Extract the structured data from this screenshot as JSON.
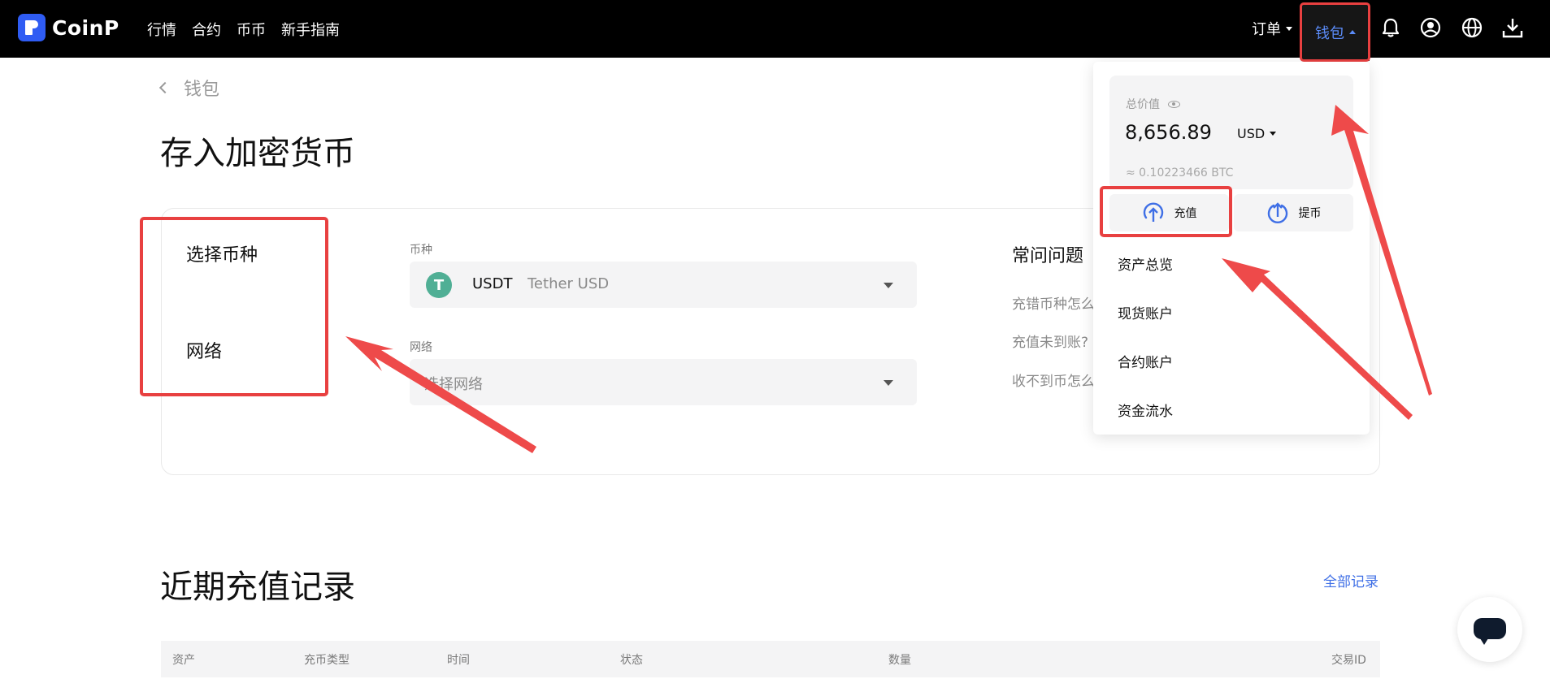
{
  "brand": {
    "name": "CoinP"
  },
  "nav": {
    "items": [
      "行情",
      "合约",
      "币币",
      "新手指南"
    ]
  },
  "nav_right": {
    "orders": "订单",
    "wallet": "钱包"
  },
  "breadcrumb": {
    "back": "钱包"
  },
  "page": {
    "title": "存入加密货币"
  },
  "steps": {
    "coin": "选择币种",
    "network": "网络"
  },
  "coin_field": {
    "label": "币种",
    "code": "USDT",
    "name": "Tether USD",
    "icon_glyph": "T"
  },
  "network_field": {
    "label": "网络",
    "placeholder": "选择网络"
  },
  "faq": {
    "title": "常问问题",
    "items": [
      "充错币种怎么",
      "充值未到账?",
      "收不到币怎么"
    ]
  },
  "recent": {
    "title": "近期充值记录",
    "all_link": "全部记录"
  },
  "table": {
    "headers": [
      "资产",
      "充币类型",
      "时间",
      "状态",
      "数量",
      "交易ID"
    ]
  },
  "dropdown": {
    "total_label": "总价值",
    "total_value": "8,656.89",
    "currency": "USD",
    "btc_value": "≈ 0.10223466 BTC",
    "deposit": "充值",
    "withdraw": "提币",
    "menu": [
      "资产总览",
      "现货账户",
      "合约账户",
      "资金流水"
    ]
  },
  "colors": {
    "accent": "#2f5cf3",
    "annotation": "#e84040",
    "link": "#3f6fe6"
  }
}
